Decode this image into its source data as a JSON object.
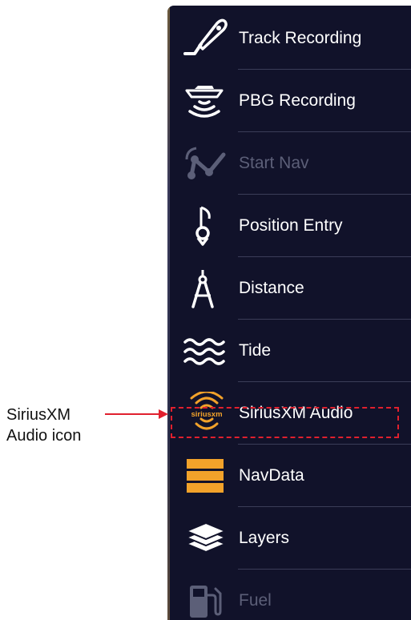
{
  "menu": {
    "items": [
      {
        "label": "Track Recording",
        "icon": "track-recording-icon",
        "enabled": true
      },
      {
        "label": "PBG Recording",
        "icon": "pbg-recording-icon",
        "enabled": true
      },
      {
        "label": "Start Nav",
        "icon": "start-nav-icon",
        "enabled": false
      },
      {
        "label": "Position Entry",
        "icon": "position-entry-icon",
        "enabled": true
      },
      {
        "label": "Distance",
        "icon": "distance-icon",
        "enabled": true
      },
      {
        "label": "Tide",
        "icon": "tide-icon",
        "enabled": true
      },
      {
        "label": "SiriusXM Audio",
        "icon": "siriusxm-audio-icon",
        "enabled": true
      },
      {
        "label": "NavData",
        "icon": "navdata-icon",
        "enabled": true
      },
      {
        "label": "Layers",
        "icon": "layers-icon",
        "enabled": true
      },
      {
        "label": "Fuel",
        "icon": "fuel-icon",
        "enabled": false
      }
    ]
  },
  "sirius_icon_text": "siriusxm",
  "callout": {
    "line1": "SiriusXM",
    "line2": "Audio icon"
  },
  "colors": {
    "panel_bg": "#11122a",
    "label_text": "#ffffff",
    "disabled_text": "#5c5f78",
    "accent_orange": "#f2a22a",
    "highlight_red": "#e0202e"
  }
}
